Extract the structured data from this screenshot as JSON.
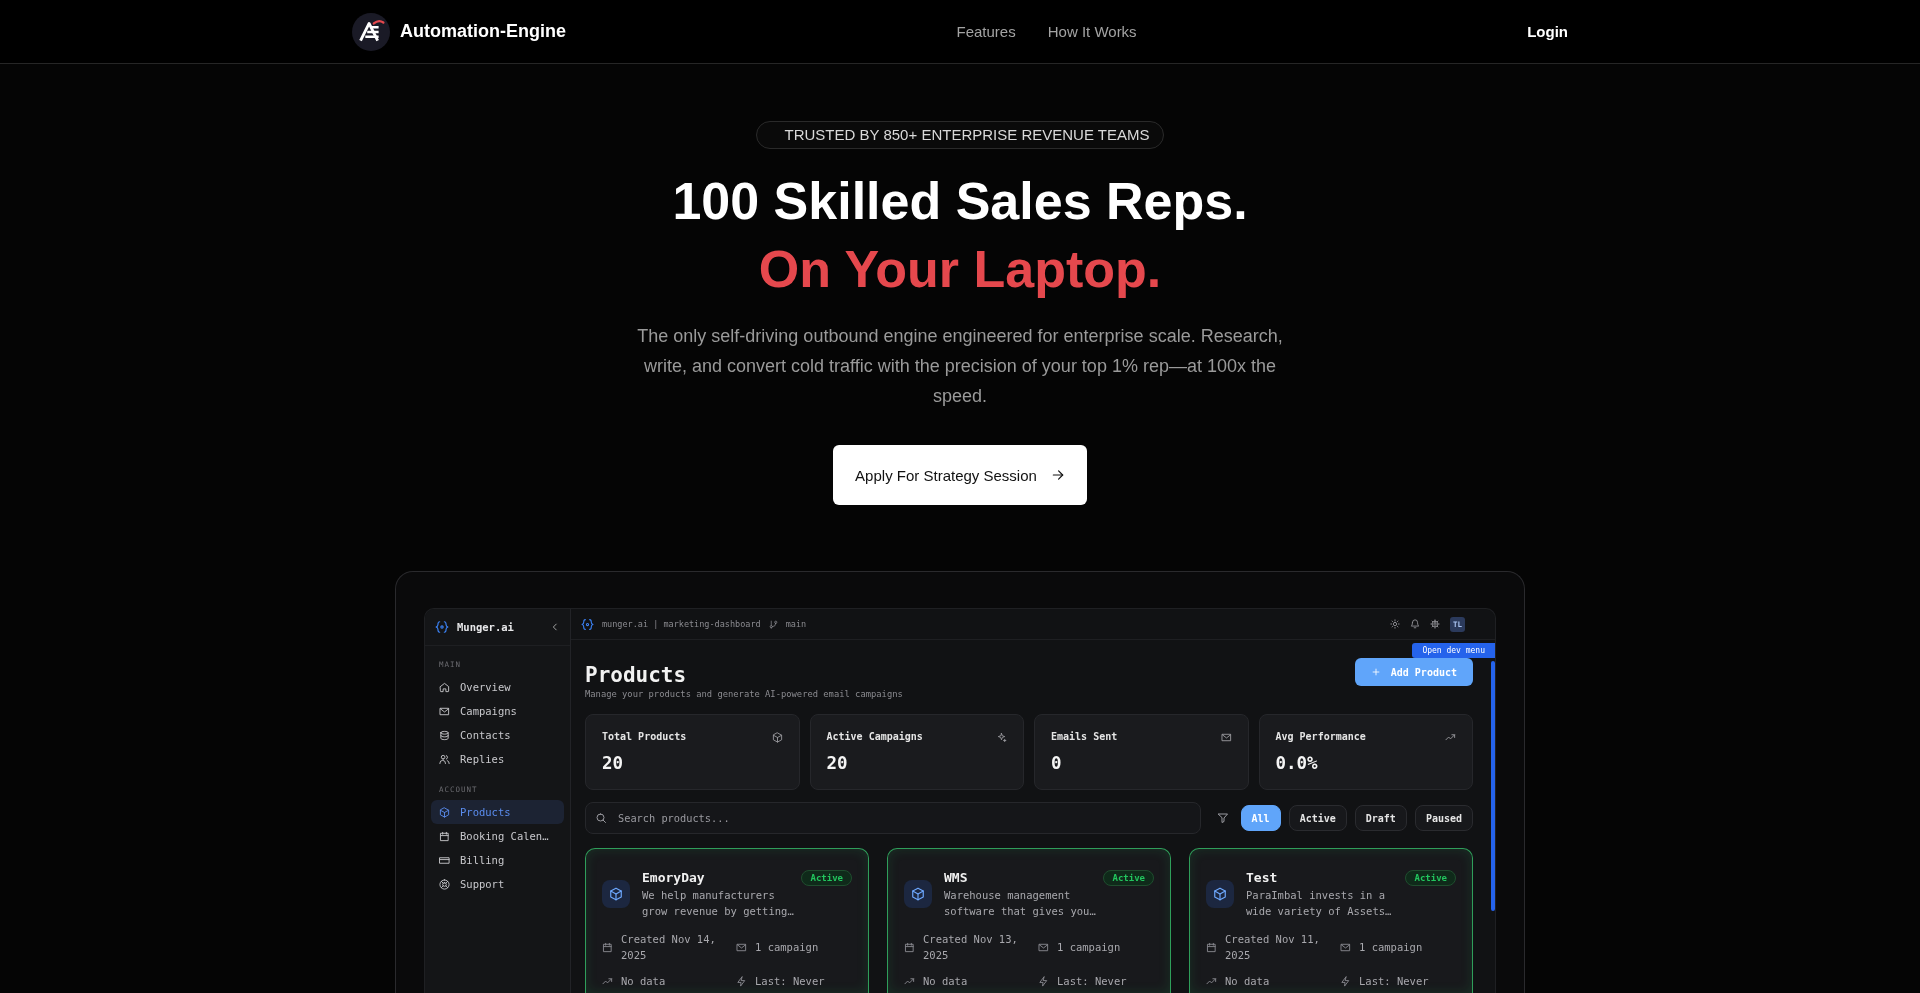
{
  "header": {
    "brand": "Automation-Engine",
    "nav": [
      "Features",
      "How It Works"
    ],
    "login": "Login"
  },
  "hero": {
    "badge": "TRUSTED BY 850+ ENTERPRISE REVENUE TEAMS",
    "title": "100 Skilled Sales Reps.",
    "title_accent": "On Your Laptop.",
    "description": "The only self-driving outbound engine engineered for enterprise scale. Research, write, and convert cold traffic with the precision of your top 1% rep—at 100x the speed.",
    "cta": "Apply For Strategy Session"
  },
  "dashboard": {
    "sidebar": {
      "brand": "Munger.ai",
      "sections": [
        {
          "heading": "MAIN",
          "items": [
            {
              "label": "Overview",
              "selected": false
            },
            {
              "label": "Campaigns",
              "selected": false
            },
            {
              "label": "Contacts",
              "selected": false
            },
            {
              "label": "Replies",
              "selected": false
            }
          ]
        },
        {
          "heading": "ACCOUNT",
          "items": [
            {
              "label": "Products",
              "selected": true
            },
            {
              "label": "Booking Calen…",
              "selected": false
            },
            {
              "label": "Billing",
              "selected": false
            },
            {
              "label": "Support",
              "selected": false
            }
          ]
        }
      ]
    },
    "topbar": {
      "project": "munger.ai | marketing-dashboard",
      "branch": "main",
      "avatar": "TL"
    },
    "dev_menu": "Open dev menu",
    "page": {
      "title": "Products",
      "subtitle": "Manage your products and generate AI-powered email campaigns",
      "add_button": "Add Product"
    },
    "stats": [
      {
        "label": "Total Products",
        "value": "20"
      },
      {
        "label": "Active Campaigns",
        "value": "20"
      },
      {
        "label": "Emails Sent",
        "value": "0"
      },
      {
        "label": "Avg Performance",
        "value": "0.0%"
      }
    ],
    "search": {
      "placeholder": "Search products..."
    },
    "filters": [
      {
        "label": "All",
        "selected": true
      },
      {
        "label": "Active",
        "selected": false
      },
      {
        "label": "Draft",
        "selected": false
      },
      {
        "label": "Paused",
        "selected": false
      }
    ],
    "products": [
      {
        "name": "EmoryDay",
        "status": "Active",
        "description": "We help manufacturers grow revenue by getting…",
        "created": "Created Nov 14, 2025",
        "campaigns": "1 campaign",
        "performance": "No data",
        "last_sent": "Last: Never"
      },
      {
        "name": "WMS",
        "status": "Active",
        "description": "Warehouse management software that gives you…",
        "created": "Created Nov 13, 2025",
        "campaigns": "1 campaign",
        "performance": "No data",
        "last_sent": "Last: Never"
      },
      {
        "name": "Test",
        "status": "Active",
        "description": "ParaImbal invests in a wide variety of Assets…",
        "created": "Created Nov 11, 2025",
        "campaigns": "1 campaign",
        "performance": "No data",
        "last_sent": "Last: Never"
      }
    ]
  }
}
